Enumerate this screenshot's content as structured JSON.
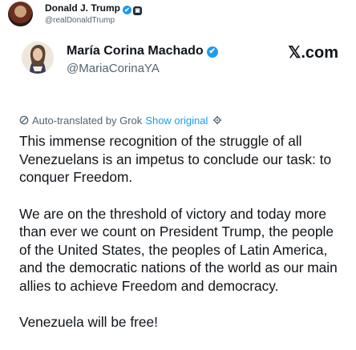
{
  "outer_post": {
    "name": "Donald J. Trump",
    "handle": "@realDonaldTrump",
    "verified_glyph": "✔",
    "affiliation_glyph": "▣"
  },
  "quoted_post": {
    "name": "María Corina Machado",
    "handle": "@MariaCorinaYA",
    "verified_glyph": "✔",
    "watermark": "𝕏.com",
    "translation_notice": "Auto-translated by Grok",
    "show_original": "Show original",
    "translate_icon": "slash-circle-icon",
    "settings_icon": "gear-icon",
    "paragraphs": [
      "This immense recognition of the struggle of all Venezuelans is an impetus to conclude our task: to conquer Freedom.",
      "We are on the threshold of victory and today more than ever we count on President Trump, the people of the United States, the peoples of Latin America, and the democratic nations of the world as our main allies to achieve Freedom and democracy.",
      "Venezuela will be free!"
    ]
  },
  "colors": {
    "text": "#0f1419",
    "muted": "#536471",
    "accent": "#1d9bf0"
  }
}
